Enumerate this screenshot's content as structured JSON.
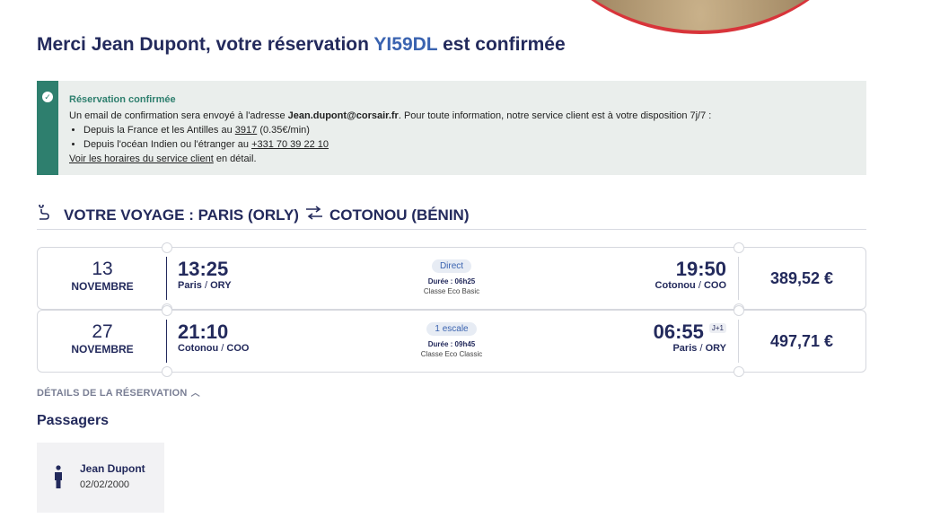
{
  "header": {
    "title_prefix": "Merci Jean Dupont, votre réservation",
    "booking_ref": "YI59DL",
    "title_suffix": "est confirmée"
  },
  "alert": {
    "title": "Réservation confirmée",
    "line1_pre": "Un email de confirmation sera envoyé à l'adresse",
    "email": "Jean.dupont@corsair.fr",
    "line1_post": ". Pour toute information, notre service client est à votre disposition 7j/7 :",
    "bullet1_pre": "Depuis la France et les Antilles au",
    "bullet1_phone": "3917",
    "bullet1_post": "(0.35€/min)",
    "bullet2_pre": "Depuis l'océan Indien ou l'étranger au",
    "bullet2_phone": "+331 70 39 22 10",
    "link_text": "Voir les horaires du service client",
    "link_post": "en détail."
  },
  "trip": {
    "label": "VOTRE VOYAGE : PARIS (ORLY)",
    "destination": "COTONOU (BÉNIN)"
  },
  "flights": [
    {
      "day": "13",
      "month": "NOVEMBRE",
      "dep_time": "13:25",
      "dep_city": "Paris",
      "dep_code": "ORY",
      "stops": "Direct",
      "duration": "Durée : 06h25",
      "cabin": "Classe Eco Basic",
      "arr_time": "19:50",
      "arr_city": "Cotonou",
      "arr_code": "COO",
      "day_offset": "",
      "price": "389,52 €"
    },
    {
      "day": "27",
      "month": "NOVEMBRE",
      "dep_time": "21:10",
      "dep_city": "Cotonou",
      "dep_code": "COO",
      "stops": "1 escale",
      "duration": "Durée : 09h45",
      "cabin": "Classe Eco Classic",
      "arr_time": "06:55",
      "arr_city": "Paris",
      "arr_code": "ORY",
      "day_offset": "J+1",
      "price": "497,71 €"
    }
  ],
  "details_link": "DÉTAILS DE LA RÉSERVATION",
  "passengers": {
    "title": "Passagers",
    "list": [
      {
        "name": "Jean Dupont",
        "dob": "02/02/2000"
      }
    ]
  },
  "colors": {
    "navy": "#232a5c",
    "accent_blue": "#3a63b0",
    "success_green": "#2e7f6e",
    "brand_red": "#d8343a"
  }
}
